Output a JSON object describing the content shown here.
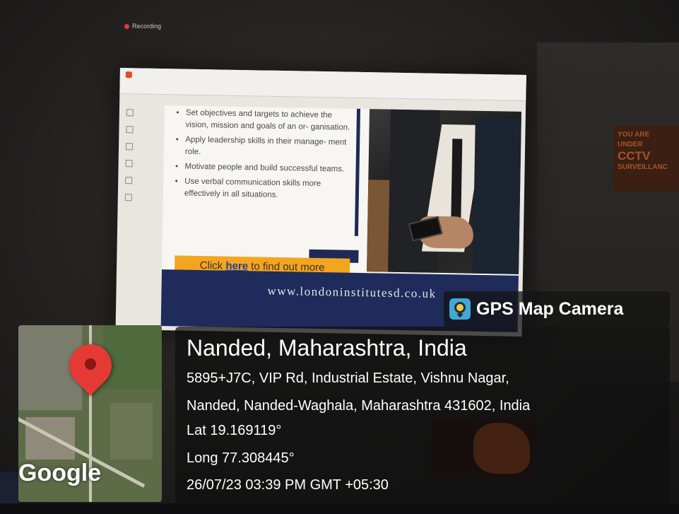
{
  "recording": {
    "label": "Recording"
  },
  "background_sign": {
    "line1": "YOU ARE",
    "line2": "UNDER",
    "line3": "CCTV",
    "line4": "SURVEILLANC"
  },
  "slide": {
    "bullets": [
      "Set objectives and targets to achieve the vision, mission and goals of an or- ganisation.",
      "Apply leadership skills in their manage- ment role.",
      "Motivate people and build successful teams.",
      "Use verbal communication skills more effectively in all situations."
    ],
    "cta_prefix": "Click ",
    "cta_link": "here",
    "cta_suffix": " to find out more",
    "url": "www.londoninstitutesd.co.uk"
  },
  "overlay": {
    "app_name": "GPS Map Camera",
    "location_title": "Nanded, Maharashtra, India",
    "address_line1": "5895+J7C, VIP Rd, Industrial Estate, Vishnu Nagar,",
    "address_line2": "Nanded, Nanded-Waghala, Maharashtra 431602, India",
    "latitude": "Lat 19.169119°",
    "longitude": "Long 77.308445°",
    "timestamp": "26/07/23 03:39 PM GMT +05:30",
    "map_logo": "Google"
  },
  "colors": {
    "pin": "#e53935",
    "cta": "#f4a51f",
    "navy": "#1f2b5a"
  }
}
